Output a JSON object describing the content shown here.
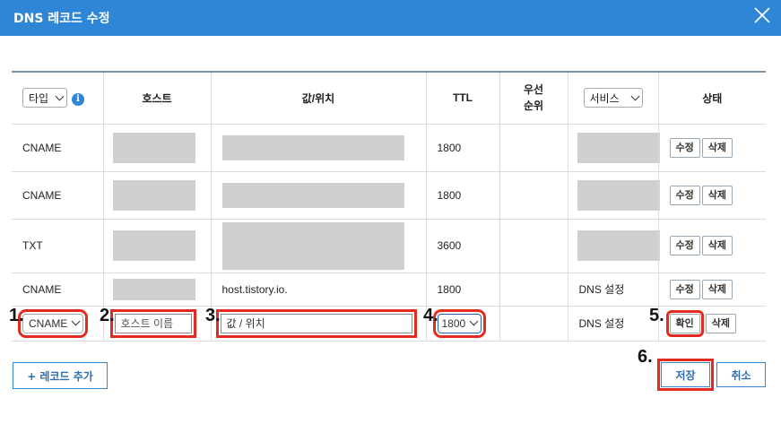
{
  "dialog": {
    "title": "DNS 레코드 수정"
  },
  "table": {
    "headers": {
      "type_select": "타입",
      "host": "호스트",
      "value": "값/위치",
      "ttl": "TTL",
      "priority": "우선\n순위",
      "service_select": "서비스",
      "status": "상태"
    },
    "rows": [
      {
        "type": "CNAME",
        "ttl": "1800",
        "service": "",
        "value": ""
      },
      {
        "type": "CNAME",
        "ttl": "1800",
        "service": "",
        "value": ""
      },
      {
        "type": "TXT",
        "ttl": "3600",
        "service": "",
        "value": ""
      },
      {
        "type": "CNAME",
        "ttl": "1800",
        "service": "DNS 설정",
        "value": "host.tistory.io."
      }
    ],
    "row_buttons": {
      "edit": "수정",
      "delete": "삭제"
    },
    "edit_row": {
      "type_selected": "CNAME",
      "host_placeholder": "호스트 이름",
      "value_placeholder": "값 / 위치",
      "ttl_selected": "1800",
      "service": "DNS 설정",
      "confirm": "확인",
      "delete": "삭제"
    }
  },
  "annotations": [
    "1.",
    "2.",
    "3.",
    "4.",
    "5.",
    "6."
  ],
  "footer": {
    "add_record": "+ 레코드 추가",
    "save": "저장",
    "cancel": "취소"
  },
  "colors": {
    "titlebar": "#2f86d6",
    "highlight": "#e32b22"
  }
}
